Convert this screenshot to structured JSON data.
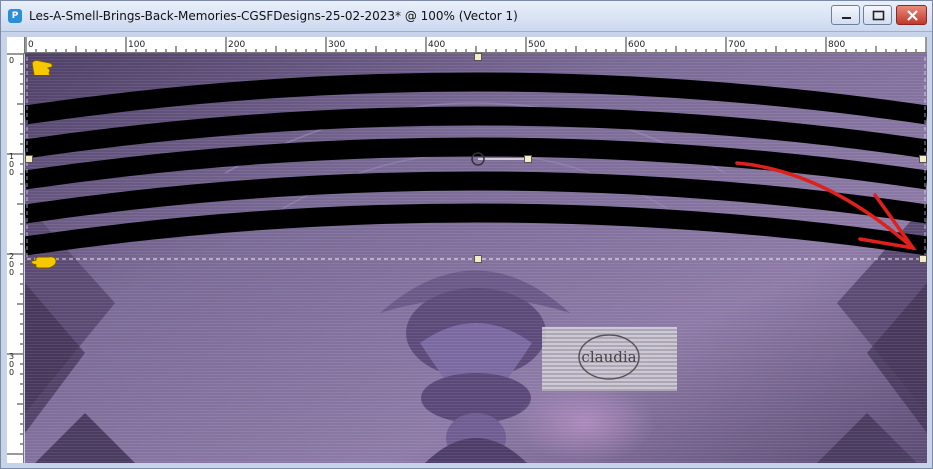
{
  "window": {
    "title": "Les-A-Smell-Brings-Back-Memories-CGSFDesigns-25-02-2023* @ 100% (Vector 1)",
    "app_icon": "paintshop-pro-icon",
    "buttons": {
      "minimize": "minimize-icon",
      "maximize": "maximize-icon",
      "close": "close-icon"
    }
  },
  "ruler_top": {
    "labels": [
      "0",
      "100",
      "200",
      "300",
      "400",
      "500",
      "600",
      "700",
      "800"
    ]
  },
  "ruler_left": {
    "labels": [
      "0",
      "1\n0\n0",
      "2\n0\n0",
      "3\n0\n0"
    ]
  },
  "canvas": {
    "background_color": "#6b5a84",
    "stripe_color": "#000000",
    "arrow_color": "#e0201a",
    "watermark_text": "claudia"
  },
  "colors": {
    "titlebar": "#d9e3f3",
    "handle": "#f3ecc7",
    "pointer": "#f5c800"
  }
}
